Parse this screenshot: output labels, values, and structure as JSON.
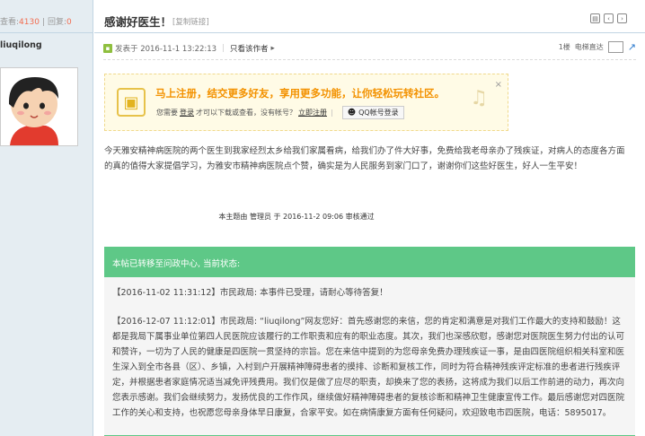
{
  "sidebar": {
    "views_label": "查看:",
    "views": "4130",
    "replies_label": "回复:",
    "replies": "0",
    "username": "liuqilong"
  },
  "thread": {
    "title": "感谢好医生！",
    "copy_link": "[复制链接]",
    "posted_at": "发表于 2016-11-1 13:22:13",
    "author_only": "只看该作者",
    "floor": "1楼",
    "jump_label": "电梯直达"
  },
  "register_box": {
    "headline": "马上注册，结交更多好友，享用更多功能，让你轻松玩转社区。",
    "prefix": "您需要",
    "login_link": "登录",
    "middle": "才可以下载或查看，没有帐号？",
    "register_link": "立即注册",
    "qq_button": "QQ帐号登录"
  },
  "post": {
    "body": "今天雅安精神病医院的两个医生到我家经烈太乡给我们家属看病，给我们办了件大好事，免费给我老母亲办了残疾证，对病人的态度各方面的真的值得大家提倡学习，为雅安市精神病医院点个赞，确实是为人民服务到家门口了，谢谢你们这些好医生，好人一生平安！",
    "edit_note": "本主题由 管理员 于 2016-11-2 09:06 审核通过"
  },
  "status": {
    "header": "本帖已转移至问政中心, 当前状态:",
    "item1": "【2016-11-02 11:31:12】市民政局:  本事件已受理，请耐心等待答复！",
    "item2": "【2016-12-07 11:12:01】市民政局:  “liuqilong”网友您好：首先感谢您的来信，您的肯定和满意是对我们工作最大的支持和鼓励！这都是我局下属事业单位第四人民医院应该履行的工作职责和应有的职业态度。其次，我们也深感欣慰，感谢您对医院医生努力付出的认可和赞许，一切为了人民的健康是四医院一贯坚持的宗旨。您在来信中提到的为您母亲免费办理残疾证一事，是由四医院组织相关科室和医生深入到全市各县（区）、乡镇，入村到户开展精神障碍患者的摸排、诊断和复核工作，同时为符合精神残疾评定标准的患者进行残疾评定，并根据患者家庭情况适当减免评残费用。我们仅是做了应尽的职责，却换来了您的表扬，这将成为我们以后工作前进的动力，再次向您表示感谢。我们会继续努力，发扬优良的工作作风，继续做好精神障碍患者的复核诊断和精神卫生健康宣传工作。最后感谢您对四医院工作的关心和支持，也祝愿您母亲身体早日康复，合家平安。如在病情康复方面有任何疑问，欢迎致电市四医院，电话：5895017。"
  },
  "colors": {
    "accent_green": "#5ec887",
    "highlight_orange": "#f39200",
    "count_red": "#f26c4f"
  }
}
